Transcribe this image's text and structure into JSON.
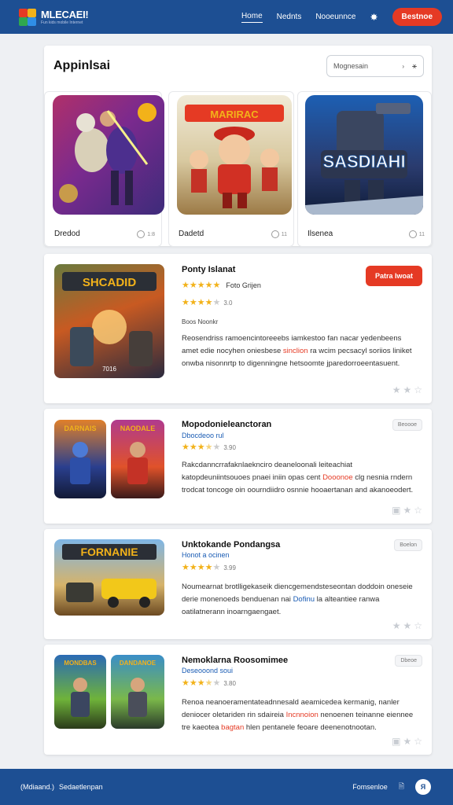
{
  "header": {
    "brand_name": "MLECAEI!",
    "brand_tag": "Fun kids mobile Internet",
    "nav": [
      "Home",
      "Nednts",
      "Nooeunnce"
    ],
    "cta": "Bestnoe"
  },
  "top_section": {
    "title": "Appinlsai",
    "search_placeholder": "Mognesain",
    "tiles": [
      {
        "name": "Dredod",
        "meta": "1:8"
      },
      {
        "name": "Dadetd",
        "meta": "11"
      },
      {
        "name": "Ilsenea",
        "meta": "11"
      }
    ]
  },
  "cards": [
    {
      "title": "Ponty Islanat",
      "subtitle": "Foto Grijen",
      "rating": 4,
      "rating_label": "3.0",
      "small": "Boos Noonkr",
      "cta": "Patra Iwoat",
      "desc_parts": [
        {
          "t": "Reosendriss ramoencintoreeebs iamkestoo fan nacar yedenbeens amet edie nocyhen oniesbese ",
          "c": ""
        },
        {
          "t": "sinclion",
          "c": "red"
        },
        {
          "t": " ra wcim pecsacyl soriios liniket onwba nisonnrtp to digenningne hetsoomte jparedorroeentasuent.",
          "c": ""
        }
      ],
      "art_label": "SHCADID",
      "art_foot": "7016"
    },
    {
      "title": "Mopodonieleanctoran",
      "subtitle": "Dbocdeoo rul",
      "rating": 3,
      "rating_label": "3.90",
      "tag": "Beoooe",
      "desc_parts": [
        {
          "t": "Rakcdanncrrafaknlaeknciro deaneloonali leiteachiat katopdeuniintsouoes pnaei iniin opas cent ",
          "c": ""
        },
        {
          "t": "Dooonoe",
          "c": "red"
        },
        {
          "t": " clg nesnia rndern trodcat toncoge oin oourndiidro osnnie hooaertanan and akanoeodert.",
          "c": ""
        }
      ],
      "art_labels": [
        "DARNAIS",
        "NAODALE"
      ]
    },
    {
      "title": "Unktokande Pondangsa",
      "subtitle": "Honot a ocinen",
      "rating": 4,
      "rating_label": "3.99",
      "tag": "Boelon",
      "desc_parts": [
        {
          "t": "Noumearnat brotlligekaseik diencgemendsteseontan doddoin oneseie derie monenoeds benduenan nai ",
          "c": ""
        },
        {
          "t": "Dofinu",
          "c": "blue"
        },
        {
          "t": " la alteantiee ranwa oatilatnerann inoarngaengaet.",
          "c": ""
        }
      ],
      "art_label": "FORNANIE"
    },
    {
      "title": "Nemoklarna Roosomimee",
      "subtitle": "Deseooond soui",
      "rating": 3,
      "rating_label": "3.80",
      "tag": "Dbeoe",
      "desc_parts": [
        {
          "t": "Renoa neanoeramentateadnnesald aeamicedea kermanig, nanler deniocer oletariden rin sdaireia ",
          "c": ""
        },
        {
          "t": "Incnnoion",
          "c": "red"
        },
        {
          "t": " nenoenen teinanne eiennee tre kaeotea ",
          "c": ""
        },
        {
          "t": "bagtan",
          "c": "red"
        },
        {
          "t": " hlen pentanele feoare deenenotnootan.",
          "c": ""
        }
      ],
      "art_labels": [
        "MONDBAS",
        "DANDANOE"
      ]
    }
  ],
  "footer": {
    "left_a": "(Mdiaand.)",
    "left_b": "Sedaetlenpan",
    "right_label": "Fomsenloe",
    "circle": "Я"
  },
  "colors": {
    "primary": "#1d4f93",
    "accent": "#e53a24",
    "star": "#f2b21a",
    "link": "#1a5cb4"
  }
}
